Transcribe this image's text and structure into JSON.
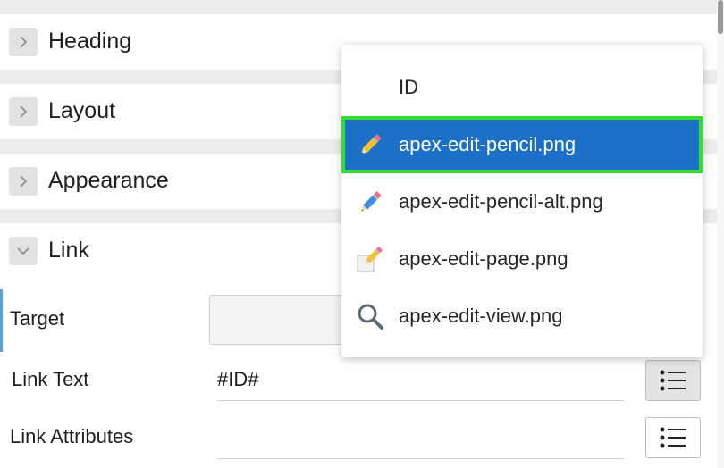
{
  "sections": {
    "heading": {
      "title": "Heading"
    },
    "layout": {
      "title": "Layout"
    },
    "appearance": {
      "title": "Appearance"
    },
    "link": {
      "title": "Link"
    }
  },
  "fields": {
    "target": {
      "label": "Target",
      "value": ""
    },
    "link_text": {
      "label": "Link Text",
      "value": "#ID#"
    },
    "link_attributes": {
      "label": "Link Attributes",
      "value": ""
    }
  },
  "dropdown": {
    "header": "ID",
    "items": [
      {
        "label": "apex-edit-pencil.png",
        "icon": "pencil-icon",
        "selected": true
      },
      {
        "label": "apex-edit-pencil-alt.png",
        "icon": "pencil-alt-icon",
        "selected": false
      },
      {
        "label": "apex-edit-page.png",
        "icon": "edit-page-icon",
        "selected": false
      },
      {
        "label": "apex-edit-view.png",
        "icon": "magnifier-icon",
        "selected": false
      }
    ]
  },
  "colors": {
    "selection": "#1c70c8",
    "selection_outline": "#33dd33",
    "panel_band": "#ececec"
  }
}
